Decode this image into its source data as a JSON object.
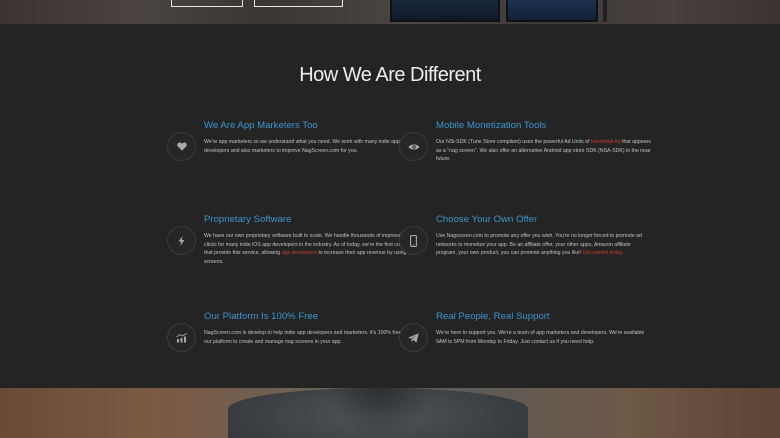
{
  "section": {
    "title": "How We Are Different"
  },
  "features": [
    {
      "icon": "heart-icon",
      "title": "We Are App Marketers Too",
      "text_before": "We're app marketers so we understand what you need. We work with many indie app developers and also marketers to improve NagScreen.com for you.",
      "link": "",
      "text_after": ""
    },
    {
      "icon": "eye-icon",
      "title": "Mobile Monetization Tools",
      "text_before": "Our NSi-SDK (Tune Store compliant) uses the powerful Ad Units of ",
      "link": "Interstitial Ad",
      "text_after": " that appears as a \"nag screen\". We also offer an alternative Android app store SDK (NSA-SDK) in the near future."
    },
    {
      "icon": "lightning-icon",
      "title": "Proprietary Software",
      "text_before": "We have our own proprietary software built to scale. We handle thousands of impressions & clicks for many indie iOS app developers in the industry. As of today, we're the first company that provide this service, allowing ",
      "link": "app developers",
      "text_after": " to increase their app revenue by using nag screens."
    },
    {
      "icon": "smartphone-icon",
      "title": "Choose Your Own Offer",
      "text_before": "Use Nagscreen.com to promote any offer you wish. You're no longer forced to promote ad networks to monetize your app. Be an affiliate offer, your other apps, Amazon affiliate program, your own product, you can promote anything you like! ",
      "link": "Get started today",
      "text_after": "."
    },
    {
      "icon": "chart-icon",
      "title": "Our Platform Is 100% Free",
      "text_before": "NagScreen.com is develop to help indie app developers and marketers. It's 100% free to use our platform to create and manage nag screens in your app.",
      "link": "",
      "text_after": ""
    },
    {
      "icon": "paper-plane-icon",
      "title": "Real People, Real Support",
      "text_before": "We're here to support you. We're a team of app marketers and developers. We're available 9AM to 5PM from Monday to Friday. Just contact us if you need help.",
      "link": "",
      "text_after": ""
    }
  ],
  "colors": {
    "accent": "#3d95ce",
    "link": "#c93e2f",
    "background": "#242424"
  }
}
